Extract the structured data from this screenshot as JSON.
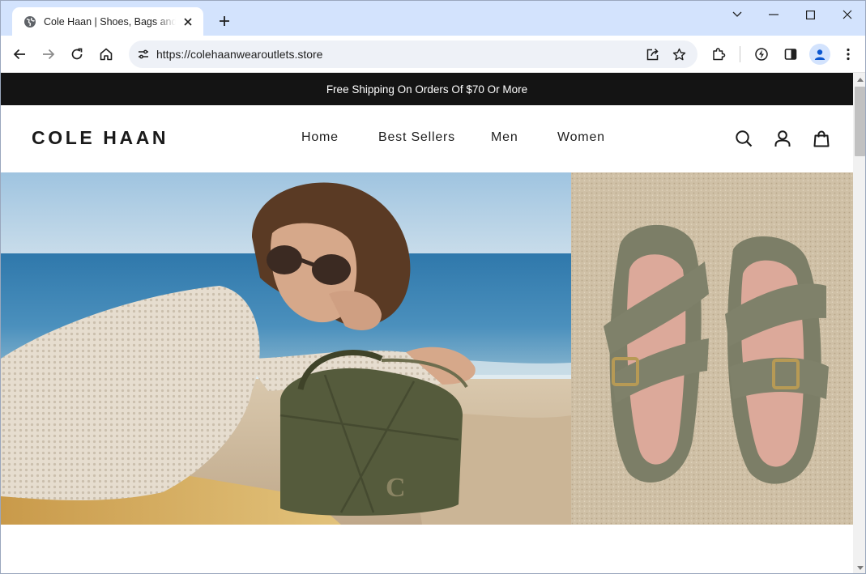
{
  "browser": {
    "tab": {
      "title": "Cole Haan | Shoes, Bags and Accessories"
    },
    "address": {
      "url": "https://colehaanwearoutlets.store"
    }
  },
  "site": {
    "announcement": "Free Shipping On Orders Of $70 Or More",
    "logo": "COLE HAAN",
    "nav": [
      "Home",
      "Best Sellers",
      "Men",
      "Women"
    ]
  },
  "colors": {
    "tabstrip": "#d3e3fd",
    "announcement_bg": "#141414",
    "text": "#1e1e1e",
    "sea": "#3f86b6",
    "sand": "#d7c6ac",
    "sandal": "#7d7f68",
    "bag": "#545a3c"
  },
  "icons": [
    "globe-icon",
    "close-icon",
    "plus-icon",
    "chevron-down-icon",
    "minimize-icon",
    "maximize-icon",
    "back-arrow-icon",
    "forward-arrow-icon",
    "reload-icon",
    "home-icon",
    "site-settings-icon",
    "share-icon",
    "star-icon",
    "puzzle-icon",
    "performance-icon",
    "side-panel-icon",
    "profile-icon",
    "kebab-menu-icon",
    "search-icon",
    "account-icon",
    "shopping-bag-icon"
  ]
}
